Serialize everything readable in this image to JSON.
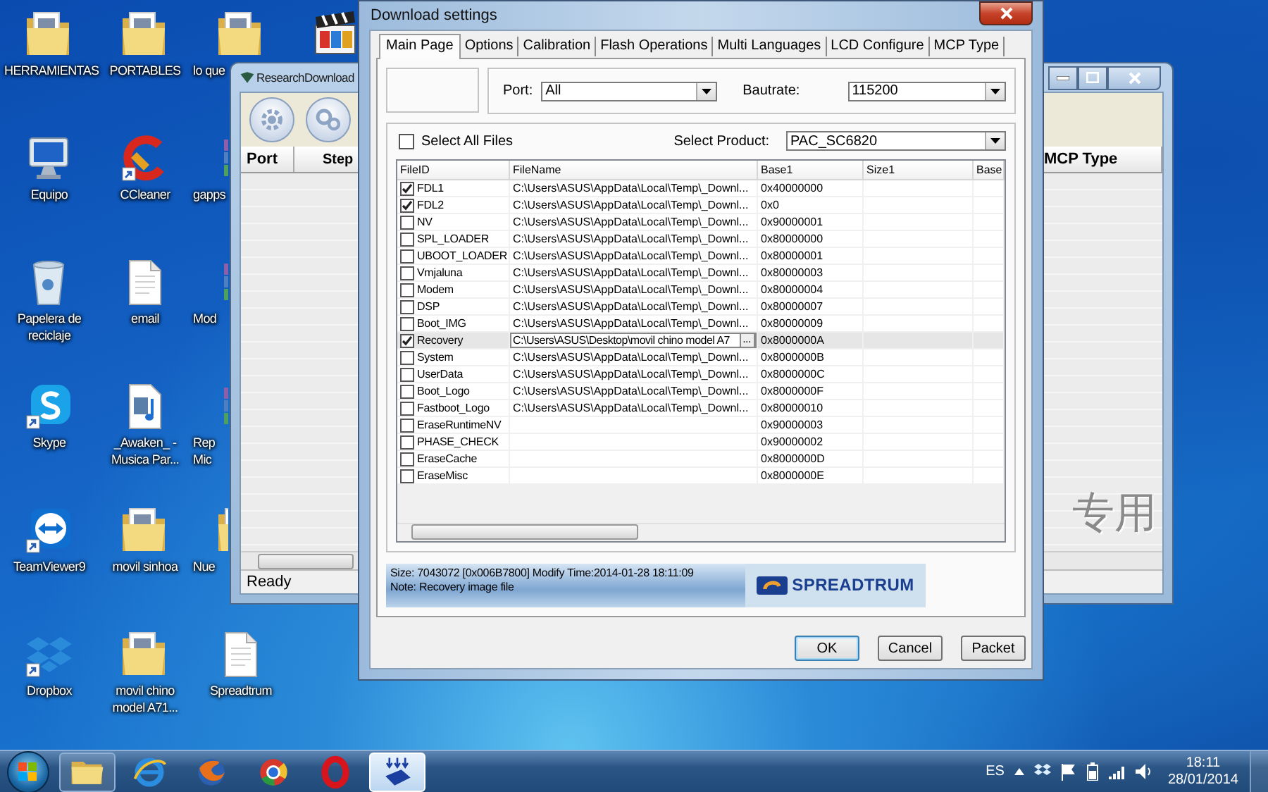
{
  "desktop": {
    "icons": [
      {
        "label": "HERRAMIENTAS",
        "kind": "folder"
      },
      {
        "label": "Equipo",
        "kind": "computer"
      },
      {
        "label": "Papelera de reciclaje",
        "kind": "recycle"
      },
      {
        "label": "Skype",
        "kind": "skype"
      },
      {
        "label": "TeamViewer9",
        "kind": "teamviewer"
      },
      {
        "label": "Dropbox",
        "kind": "dropbox"
      },
      {
        "label": "PORTABLES",
        "kind": "folder"
      },
      {
        "label": "CCleaner",
        "kind": "cleaner"
      },
      {
        "label": "email",
        "kind": "document"
      },
      {
        "label": "_Awaken_ - Musica Par...",
        "kind": "audio"
      },
      {
        "label": "movil sinhoa",
        "kind": "folder"
      },
      {
        "label": "movil chino model A71...",
        "kind": "folder"
      },
      {
        "label": "lo que",
        "kind": "folder"
      },
      {
        "label": "gapps",
        "kind": "archive"
      },
      {
        "label": "Mod",
        "kind": "archive"
      },
      {
        "label": "Rep Mic",
        "kind": "archive"
      },
      {
        "label": "Nue",
        "kind": "folder"
      },
      {
        "label": "Spreadtrum",
        "kind": "document"
      },
      {
        "kind": "media"
      }
    ]
  },
  "research_window": {
    "title": "ResearchDownload",
    "columns": [
      "Port",
      "Step",
      "MCP Type"
    ],
    "watermark": "专用",
    "status": "Ready"
  },
  "dialog": {
    "title": "Download settings",
    "tabs": [
      {
        "label": "Main Page",
        "selected": true
      },
      {
        "label": "Options",
        "selected": false
      },
      {
        "label": "Calibration",
        "selected": false
      },
      {
        "label": "Flash Operations",
        "selected": false
      },
      {
        "label": "Multi Languages",
        "selected": false
      },
      {
        "label": "LCD Configure",
        "selected": false
      },
      {
        "label": "MCP Type",
        "selected": false
      }
    ],
    "port": {
      "label": "Port:",
      "value": "All"
    },
    "baudrate": {
      "label": "Bautrate:",
      "value": "115200"
    },
    "select_all": {
      "label": "Select All Files",
      "checked": false
    },
    "product": {
      "label": "Select Product:",
      "value": "PAC_SC6820"
    },
    "table": {
      "columns": [
        "FileID",
        "FileName",
        "Base1",
        "Size1",
        "Base"
      ],
      "browse_button": "...",
      "rows": [
        {
          "id": "FDL1",
          "file": "C:\\Users\\ASUS\\AppData\\Local\\Temp\\_Downl...",
          "base": "0x40000000",
          "checked": true,
          "selected": false,
          "kind": "plain"
        },
        {
          "id": "FDL2",
          "file": "C:\\Users\\ASUS\\AppData\\Local\\Temp\\_Downl...",
          "base": "0x0",
          "checked": true,
          "selected": false,
          "kind": "plain"
        },
        {
          "id": "NV",
          "file": "C:\\Users\\ASUS\\AppData\\Local\\Temp\\_Downl...",
          "base": "0x90000001",
          "checked": false,
          "selected": false,
          "kind": "plain"
        },
        {
          "id": "SPL_LOADER",
          "file": "C:\\Users\\ASUS\\AppData\\Local\\Temp\\_Downl...",
          "base": "0x80000000",
          "checked": false,
          "selected": false,
          "kind": "plain"
        },
        {
          "id": "UBOOT_LOADER",
          "file": "C:\\Users\\ASUS\\AppData\\Local\\Temp\\_Downl...",
          "base": "0x80000001",
          "checked": false,
          "selected": false,
          "kind": "plain"
        },
        {
          "id": "Vmjaluna",
          "file": "C:\\Users\\ASUS\\AppData\\Local\\Temp\\_Downl...",
          "base": "0x80000003",
          "checked": false,
          "selected": false,
          "kind": "plain"
        },
        {
          "id": "Modem",
          "file": "C:\\Users\\ASUS\\AppData\\Local\\Temp\\_Downl...",
          "base": "0x80000004",
          "checked": false,
          "selected": false,
          "kind": "plain"
        },
        {
          "id": "DSP",
          "file": "C:\\Users\\ASUS\\AppData\\Local\\Temp\\_Downl...",
          "base": "0x80000007",
          "checked": false,
          "selected": false,
          "kind": "plain"
        },
        {
          "id": "Boot_IMG",
          "file": "C:\\Users\\ASUS\\AppData\\Local\\Temp\\_Downl...",
          "base": "0x80000009",
          "checked": false,
          "selected": false,
          "kind": "plain"
        },
        {
          "id": "Recovery",
          "file": "C:\\Users\\ASUS\\Desktop\\movil chino model A7",
          "base": "0x8000000A",
          "checked": true,
          "selected": true,
          "kind": "edit"
        },
        {
          "id": "System",
          "file": "C:\\Users\\ASUS\\AppData\\Local\\Temp\\_Downl...",
          "base": "0x8000000B",
          "checked": false,
          "selected": false,
          "kind": "plain"
        },
        {
          "id": "UserData",
          "file": "C:\\Users\\ASUS\\AppData\\Local\\Temp\\_Downl...",
          "base": "0x8000000C",
          "checked": false,
          "selected": false,
          "kind": "plain"
        },
        {
          "id": "Boot_Logo",
          "file": "C:\\Users\\ASUS\\AppData\\Local\\Temp\\_Downl...",
          "base": "0x8000000F",
          "checked": false,
          "selected": false,
          "kind": "plain"
        },
        {
          "id": "Fastboot_Logo",
          "file": "C:\\Users\\ASUS\\AppData\\Local\\Temp\\_Downl...",
          "base": "0x80000010",
          "checked": false,
          "selected": false,
          "kind": "plain"
        },
        {
          "id": "EraseRuntimeNV",
          "base": "0x90000003",
          "checked": false,
          "selected": false,
          "kind": "plain"
        },
        {
          "id": "PHASE_CHECK",
          "base": "0x90000002",
          "checked": false,
          "selected": false,
          "kind": "plain"
        },
        {
          "id": "EraseCache",
          "base": "0x8000000D",
          "checked": false,
          "selected": false,
          "kind": "plain"
        },
        {
          "id": "EraseMisc",
          "base": "0x8000000E",
          "checked": false,
          "selected": false,
          "kind": "plain"
        }
      ]
    },
    "info": {
      "lines": [
        "Size: 7043072 [0x006B7800] Modify Time:2014-01-28 18:11:09",
        "Note: Recovery image file"
      ],
      "logo": "SPREADTRUM"
    },
    "buttons": [
      "OK",
      "Cancel",
      "Packet"
    ]
  },
  "taskbar": {
    "apps": [
      {
        "kind": "explorer",
        "running": true,
        "active": false
      },
      {
        "kind": "ie",
        "running": false,
        "active": false
      },
      {
        "kind": "firefox",
        "running": false,
        "active": false
      },
      {
        "kind": "chrome",
        "running": false,
        "active": false
      },
      {
        "kind": "opera",
        "running": false,
        "active": false
      },
      {
        "kind": "download",
        "running": true,
        "active": true
      }
    ],
    "language": "ES",
    "time": "18:11",
    "date": "28/01/2014"
  }
}
